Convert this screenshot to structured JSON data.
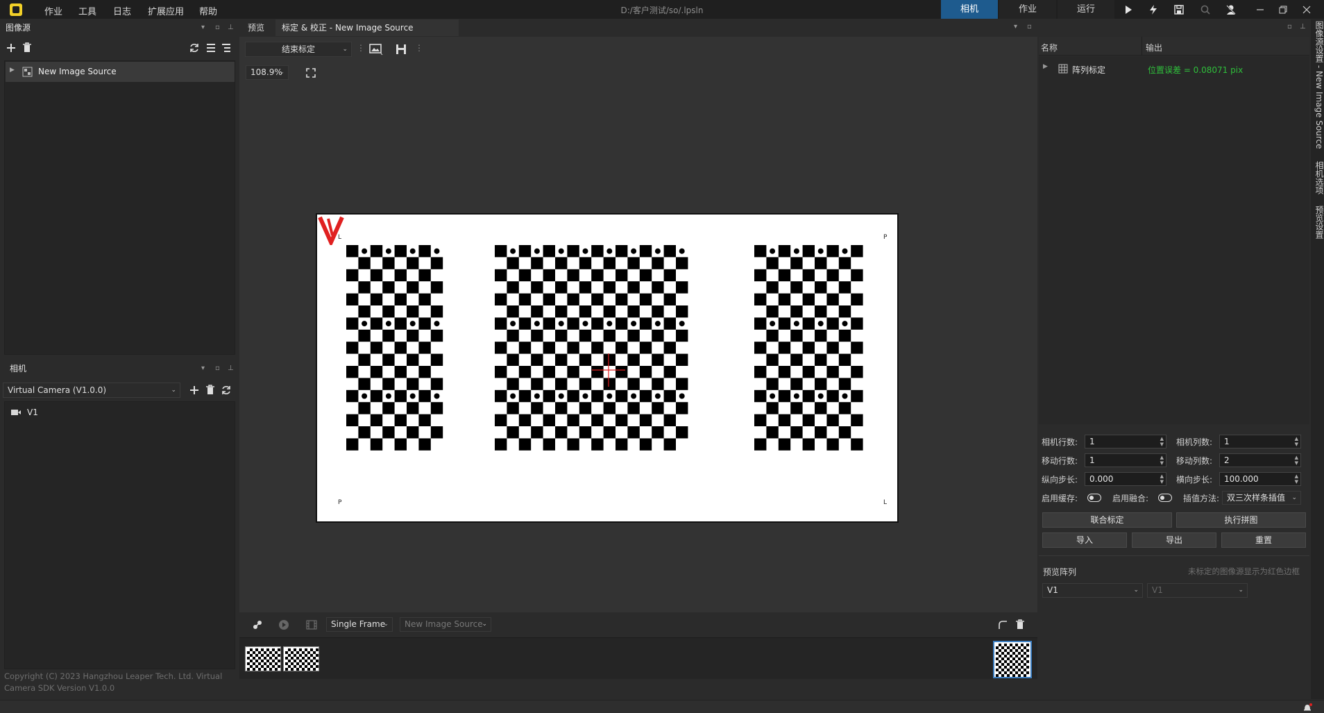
{
  "app": {
    "menus": [
      "作业",
      "工具",
      "日志",
      "扩展应用",
      "帮助"
    ],
    "document_path": "D:/客户测试/so/.lpsln",
    "mode_tabs": [
      "相机",
      "作业",
      "运行"
    ],
    "active_mode": "相机"
  },
  "image_source_panel": {
    "title": "图像源",
    "items": [
      {
        "label": "New Image Source"
      }
    ]
  },
  "camera_panel": {
    "title": "相机",
    "camera_select": "Virtual Camera (V1.0.0)",
    "items": [
      {
        "label": "V1"
      }
    ],
    "copyright": "Copyright (C) 2023 Hangzhou Leaper Tech. Ltd. Virtual Camera SDK Version V1.0.0"
  },
  "center": {
    "tabs": [
      "预览",
      "标定 & 校正  -  New Image Source"
    ],
    "active_tab_index": 1,
    "end_calib_label": "结束标定",
    "zoom": "108.9%",
    "image_corner_labels": {
      "top_left": "L",
      "top_right": "P",
      "bottom_left": "P",
      "bottom_right": "L"
    },
    "frame_mode": "Single Frame",
    "source_select": "New Image Source"
  },
  "right_panel": {
    "columns": [
      "名称",
      "输出"
    ],
    "result_name": "阵列标定",
    "result_value": "位置误差 = 0.08071 pix",
    "result_color": "#2fbf3b",
    "params": {
      "cam_rows_label": "相机行数:",
      "cam_rows": "1",
      "cam_cols_label": "相机列数:",
      "cam_cols": "1",
      "move_rows_label": "移动行数:",
      "move_rows": "1",
      "move_cols_label": "移动列数:",
      "move_cols": "2",
      "v_step_label": "纵向步长:",
      "v_step": "0.000",
      "h_step_label": "横向步长:",
      "h_step": "100.000",
      "cache_label": "启用缓存:",
      "fusion_label": "启用融合:",
      "interp_label": "插值方法:",
      "interp": "双三次样条插值"
    },
    "buttons": {
      "joint_calib": "联合标定",
      "stitch": "执行拼图",
      "import": "导入",
      "export": "导出",
      "reset": "重置"
    },
    "preview_array": {
      "title": "预览阵列",
      "hint": "未标定的图像源显示为红色边框",
      "select1": "V1",
      "select2": "V1"
    }
  },
  "side_tabs": [
    "图像源设置 - New Image Source",
    "相机选项",
    "预览设置"
  ]
}
